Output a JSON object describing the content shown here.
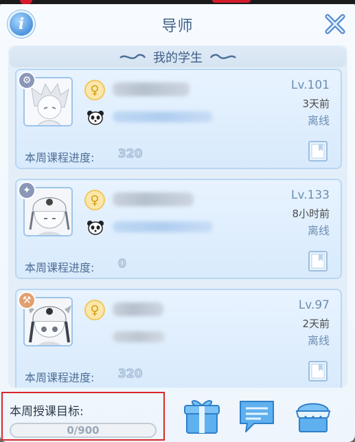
{
  "window": {
    "title": "导师"
  },
  "section": {
    "title": "我的学生"
  },
  "students": [
    {
      "gender_symbol": "♀",
      "level": "Lv.101",
      "last_online": "3天前",
      "status": "离线",
      "progress_label": "本周课程进度:",
      "progress_value": "320"
    },
    {
      "gender_symbol": "♀",
      "level": "Lv.133",
      "last_online": "8小时前",
      "status": "离线",
      "progress_label": "本周课程进度:",
      "progress_value": "0"
    },
    {
      "gender_symbol": "♀",
      "level": "Lv.97",
      "last_online": "2天前",
      "status": "离线",
      "progress_label": "本周课程进度:",
      "progress_value": "320"
    }
  ],
  "goal": {
    "label": "本周授课目标:",
    "value_text": "0/900",
    "progress_fraction": 0
  },
  "icons": {
    "info": "info-icon",
    "close": "close-icon",
    "gender": "female-icon",
    "guild": "panda-icon",
    "book": "book-icon",
    "gift": "gift-icon",
    "chat": "chat-icon",
    "shop": "shop-icon"
  },
  "colors": {
    "accent": "#3f5f88",
    "status": "#6d8eb1",
    "highlight_box": "#d8262b",
    "female_badge": "#fbe7a9"
  }
}
